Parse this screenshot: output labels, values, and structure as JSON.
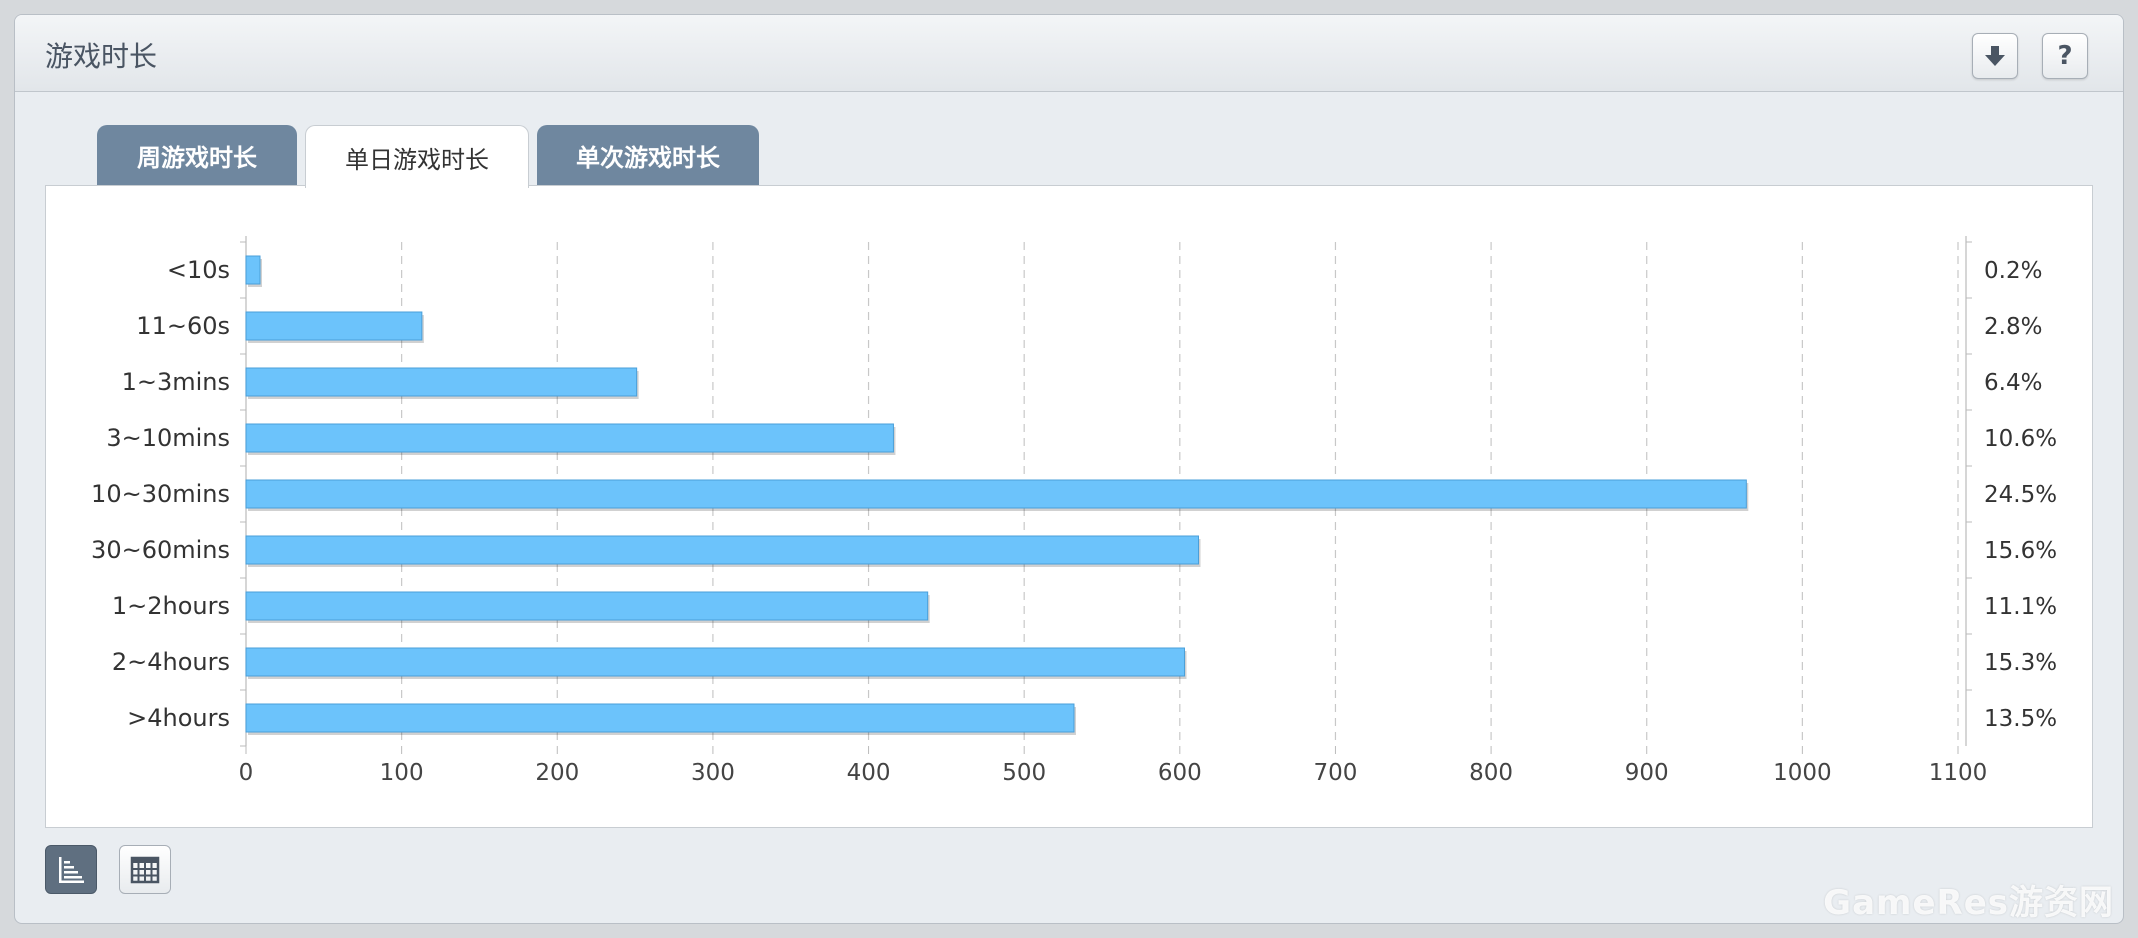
{
  "panel": {
    "title": "游戏时长",
    "download_icon": "download-arrow-icon",
    "help_label": "?"
  },
  "tabs": [
    {
      "label": "周游戏时长",
      "active": false
    },
    {
      "label": "单日游戏时长",
      "active": true
    },
    {
      "label": "单次游戏时长",
      "active": false
    }
  ],
  "colors": {
    "bar_fill": "#6cc3fb",
    "bar_stroke": "#4a9fd9",
    "tab_inactive": "#6f879f",
    "grid": "#c8c8c8"
  },
  "chart_data": {
    "type": "bar",
    "orientation": "horizontal",
    "categories": [
      "<10s",
      "11~60s",
      "1~3mins",
      "3~10mins",
      "10~30mins",
      "30~60mins",
      "1~2hours",
      "2~4hours",
      ">4hours"
    ],
    "values": [
      9,
      113,
      251,
      416,
      964,
      612,
      438,
      603,
      532
    ],
    "percent_labels": [
      "0.2%",
      "2.8%",
      "6.4%",
      "10.6%",
      "24.5%",
      "15.6%",
      "11.1%",
      "15.3%",
      "13.5%"
    ],
    "x_ticks": [
      "0",
      "100",
      "200",
      "300",
      "400",
      "500",
      "600",
      "700",
      "800",
      "900",
      "1000",
      "1100"
    ],
    "xlim": [
      0,
      1100
    ],
    "grid": true,
    "title": "",
    "xlabel": "",
    "ylabel": ""
  },
  "view_buttons": {
    "chart_icon": "bar-chart-icon",
    "table_icon": "table-grid-icon"
  },
  "watermark": "GameRes游资网"
}
